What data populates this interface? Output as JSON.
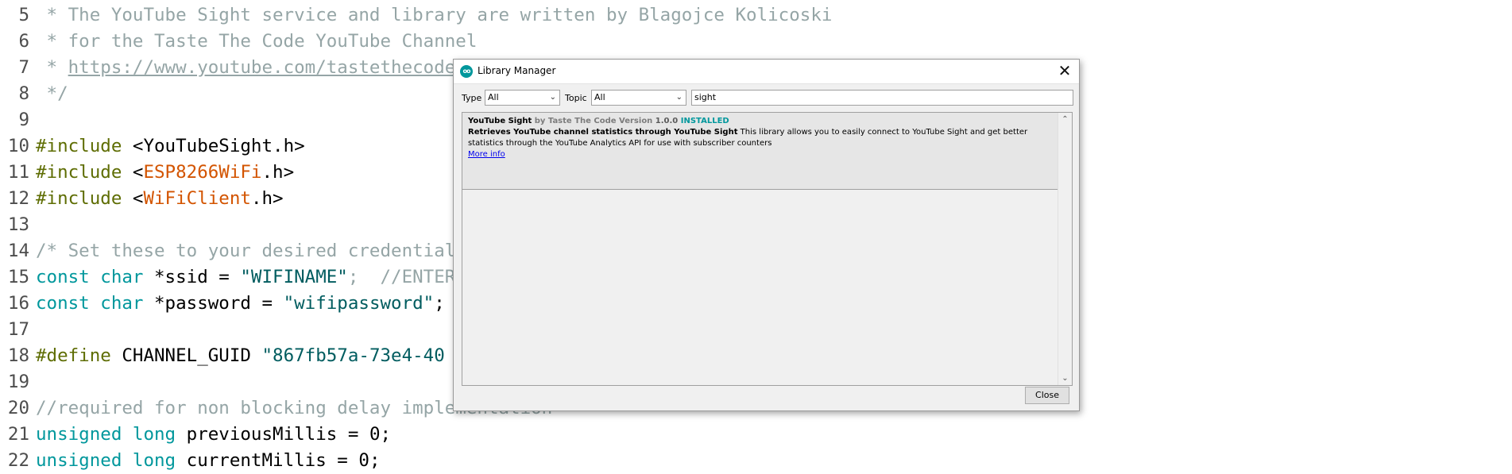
{
  "editor": {
    "lines": [
      {
        "num": "5",
        "parts": [
          {
            "t": " * The YouTube Sight service and library are written by Blagojce Kolicoski",
            "c": "cmt"
          }
        ]
      },
      {
        "num": "6",
        "parts": [
          {
            "t": " * for the Taste The Code YouTube Channel",
            "c": "cmt"
          }
        ]
      },
      {
        "num": "7",
        "parts": [
          {
            "t": " * ",
            "c": "cmt"
          },
          {
            "t": "https://www.youtube.com/tastethecode",
            "c": "cmt link"
          }
        ]
      },
      {
        "num": "8",
        "parts": [
          {
            "t": " */",
            "c": "cmt"
          }
        ]
      },
      {
        "num": "9",
        "parts": []
      },
      {
        "num": "10",
        "parts": [
          {
            "t": "#include",
            "c": "kw"
          },
          {
            "t": " <YouTubeSight.h>",
            "c": ""
          }
        ]
      },
      {
        "num": "11",
        "parts": [
          {
            "t": "#include",
            "c": "kw"
          },
          {
            "t": " <",
            "c": ""
          },
          {
            "t": "ESP8266WiFi",
            "c": "lib"
          },
          {
            "t": ".h>",
            "c": ""
          }
        ]
      },
      {
        "num": "12",
        "parts": [
          {
            "t": "#include",
            "c": "kw"
          },
          {
            "t": " <",
            "c": ""
          },
          {
            "t": "WiFiClient",
            "c": "lib"
          },
          {
            "t": ".h>",
            "c": ""
          }
        ]
      },
      {
        "num": "13",
        "parts": []
      },
      {
        "num": "14",
        "parts": [
          {
            "t": "/* Set these to your desired credentials. */",
            "c": "cmt"
          }
        ]
      },
      {
        "num": "15",
        "parts": [
          {
            "t": "const",
            "c": "type"
          },
          {
            "t": " ",
            "c": ""
          },
          {
            "t": "char",
            "c": "type"
          },
          {
            "t": " *ssid = ",
            "c": ""
          },
          {
            "t": "\"WIFINAME\"",
            "c": "str"
          },
          {
            "t": ";  //ENTER YOUR WIFI SETTINGS",
            "c": "cmt"
          }
        ]
      },
      {
        "num": "16",
        "parts": [
          {
            "t": "const",
            "c": "type"
          },
          {
            "t": " ",
            "c": ""
          },
          {
            "t": "char",
            "c": "type"
          },
          {
            "t": " *password = ",
            "c": ""
          },
          {
            "t": "\"wifipassword\"",
            "c": "str"
          },
          {
            "t": ";",
            "c": ""
          }
        ]
      },
      {
        "num": "17",
        "parts": []
      },
      {
        "num": "18",
        "parts": [
          {
            "t": "#define",
            "c": "kw"
          },
          {
            "t": " CHANNEL_GUID ",
            "c": ""
          },
          {
            "t": "\"867fb57a-73e4-40",
            "c": "str"
          }
        ]
      },
      {
        "num": "19",
        "parts": []
      },
      {
        "num": "20",
        "parts": [
          {
            "t": "//required for non blocking delay implementation",
            "c": "cmt"
          }
        ]
      },
      {
        "num": "21",
        "parts": [
          {
            "t": "unsigned",
            "c": "type"
          },
          {
            "t": " ",
            "c": ""
          },
          {
            "t": "long",
            "c": "type"
          },
          {
            "t": " previousMillis = 0;",
            "c": ""
          }
        ]
      },
      {
        "num": "22",
        "parts": [
          {
            "t": "unsigned",
            "c": "type"
          },
          {
            "t": " ",
            "c": ""
          },
          {
            "t": "long",
            "c": "type"
          },
          {
            "t": " currentMillis = 0;",
            "c": ""
          }
        ]
      }
    ]
  },
  "dialog": {
    "title": "Library Manager",
    "type_label": "Type",
    "type_value": "All",
    "topic_label": "Topic",
    "topic_value": "All",
    "search_value": "sight",
    "close_label": "Close",
    "library": {
      "name": "YouTube Sight",
      "by": " by Taste The Code",
      "version_label": " Version ",
      "version": "1.0.0",
      "status": " INSTALLED",
      "summary": "Retrieves YouTube channel statistics through YouTube Sight",
      "description": " This library allows you to easily connect to YouTube Sight and get better statistics through the YouTube Analytics API for use with subscriber counters",
      "more_info": "More info"
    }
  },
  "colors": {
    "comment": "#95a5a6",
    "keyword": "#5e6d03",
    "type": "#00979c",
    "library": "#d35400",
    "installed": "#00979c",
    "link": "#0000ee"
  }
}
